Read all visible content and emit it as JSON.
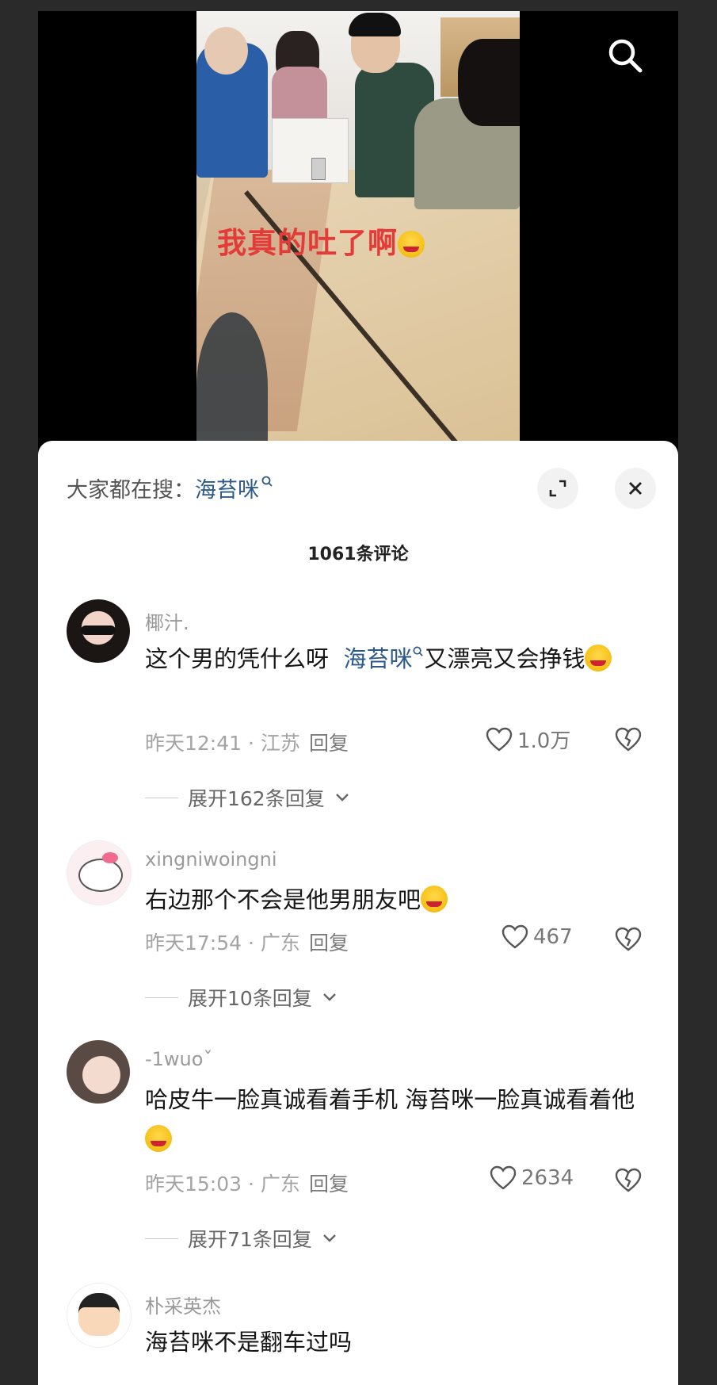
{
  "video": {
    "overlay_text": "我真的吐了啊",
    "search_icon": "search-icon"
  },
  "panel": {
    "search_prefix": "大家都在搜：",
    "search_keyword": "海苔咪",
    "comment_count": "1061条评论",
    "expand_icon": "expand-icon",
    "close_icon": "close-icon"
  },
  "comments": [
    {
      "user": "椰汁.",
      "text_before": "这个男的凭什么呀",
      "keyword": "海苔咪",
      "text_after": "又漂亮又会挣钱",
      "time": "昨天12:41 · 江苏",
      "reply_label": "回复",
      "likes": "1.0万",
      "expand": "展开162条回复"
    },
    {
      "user": "xingniwoingni",
      "text": "右边那个不会是他男朋友吧",
      "time": "昨天17:54 · 广东",
      "reply_label": "回复",
      "likes": "467",
      "expand": "展开10条回复"
    },
    {
      "user": "-1wuoˇ",
      "text": "哈皮牛一脸真诚看着手机 海苔咪一脸真诚看着他",
      "time": "昨天15:03 · 广东",
      "reply_label": "回复",
      "likes": "2634",
      "expand": "展开71条回复"
    },
    {
      "user": "朴采英杰",
      "text": "海苔咪不是翻车过吗"
    }
  ],
  "colors": {
    "accent_blue": "#2d5a8c",
    "overlay_red": "#e33b38"
  }
}
